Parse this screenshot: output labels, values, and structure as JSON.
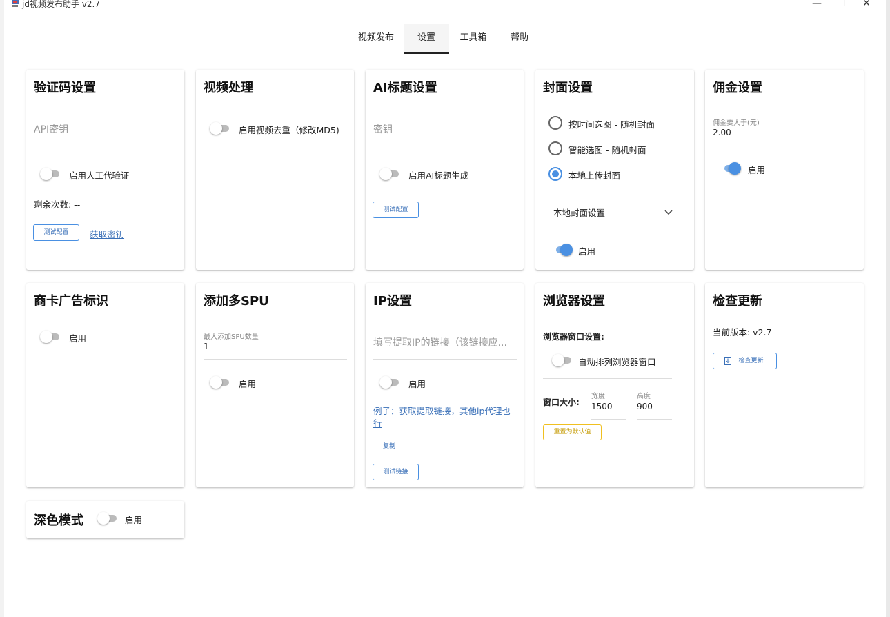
{
  "window": {
    "title": "jd视频发布助手 v2.7",
    "controls": {
      "minimize": "—",
      "maximize": "☐",
      "close": "✕"
    }
  },
  "tabs": [
    {
      "label": "视频发布",
      "active": false
    },
    {
      "label": "设置",
      "active": true
    },
    {
      "label": "工具箱",
      "active": false
    },
    {
      "label": "帮助",
      "active": false
    }
  ],
  "cards": {
    "captcha": {
      "title": "验证码设置",
      "api_key_placeholder": "API密钥",
      "manual_toggle_label": "启用人工代验证",
      "manual_toggle_on": false,
      "remaining": "剩余次数: --",
      "test_button": "测试配置",
      "get_key_link": "获取密钥"
    },
    "video": {
      "title": "视频处理",
      "dedupe_toggle_label": "启用视频去重（修改MD5)",
      "dedupe_on": false
    },
    "ai_title": {
      "title": "AI标题设置",
      "key_placeholder": "密钥",
      "toggle_label": "启用AI标题生成",
      "toggle_on": false,
      "test_button": "测试配置"
    },
    "cover": {
      "title": "封面设置",
      "options": [
        {
          "label": "按时间选图 - 随机封面",
          "checked": false
        },
        {
          "label": "智能选图 - 随机封面",
          "checked": false
        },
        {
          "label": "本地上传封面",
          "checked": true
        }
      ],
      "local_settings_label": "本地封面设置",
      "toggle_label": "启用",
      "toggle_on": true
    },
    "commission": {
      "title": "佣金设置",
      "min_label": "佣金要大于(元)",
      "min_value": "2.00",
      "toggle_label": "启用",
      "toggle_on": true
    },
    "ad_mark": {
      "title": "商卡广告标识",
      "toggle_label": "启用",
      "toggle_on": false
    },
    "multi_spu": {
      "title": "添加多SPU",
      "max_label": "最大添加SPU数量",
      "max_value": "1",
      "toggle_label": "启用",
      "toggle_on": false
    },
    "ip": {
      "title": "IP设置",
      "url_placeholder": "填写提取IP的链接（该链接应...",
      "toggle_label": "启用",
      "toggle_on": false,
      "example_link": "例子：获取提取链接，其他ip代理也行",
      "copy_button": "复制",
      "test_button": "测试链接"
    },
    "browser": {
      "title": "浏览器设置",
      "window_settings_label": "浏览器窗口设置:",
      "arrange_toggle_label": "自动排列浏览器窗口",
      "arrange_on": false,
      "size_label": "窗口大小:",
      "width_label": "宽度",
      "width_value": "1500",
      "height_label": "高度",
      "height_value": "900",
      "reset_button": "重置为默认值"
    },
    "update": {
      "title": "检查更新",
      "current_version": "当前版本: v2.7",
      "check_button": "检查更新"
    },
    "dark_mode": {
      "title": "深色模式",
      "toggle_label": "启用",
      "toggle_on": false
    }
  },
  "colors": {
    "accent": "#4a90e2",
    "link": "#3a70b8",
    "warning": "#f0c020"
  }
}
